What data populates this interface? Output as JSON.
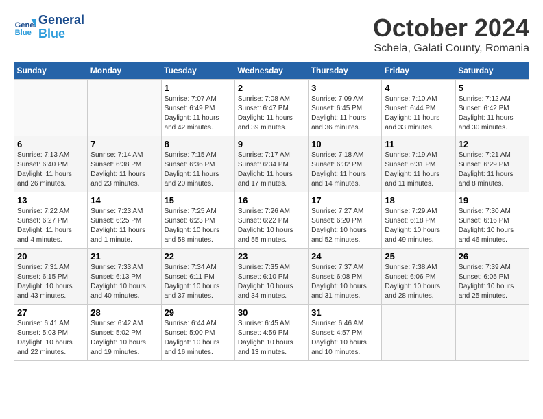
{
  "header": {
    "logo": {
      "line1": "General",
      "line2": "Blue"
    },
    "title": "October 2024",
    "location": "Schela, Galati County, Romania"
  },
  "calendar": {
    "days_of_week": [
      "Sunday",
      "Monday",
      "Tuesday",
      "Wednesday",
      "Thursday",
      "Friday",
      "Saturday"
    ],
    "weeks": [
      [
        {
          "day": "",
          "info": ""
        },
        {
          "day": "",
          "info": ""
        },
        {
          "day": "1",
          "info": "Sunrise: 7:07 AM\nSunset: 6:49 PM\nDaylight: 11 hours and 42 minutes."
        },
        {
          "day": "2",
          "info": "Sunrise: 7:08 AM\nSunset: 6:47 PM\nDaylight: 11 hours and 39 minutes."
        },
        {
          "day": "3",
          "info": "Sunrise: 7:09 AM\nSunset: 6:45 PM\nDaylight: 11 hours and 36 minutes."
        },
        {
          "day": "4",
          "info": "Sunrise: 7:10 AM\nSunset: 6:44 PM\nDaylight: 11 hours and 33 minutes."
        },
        {
          "day": "5",
          "info": "Sunrise: 7:12 AM\nSunset: 6:42 PM\nDaylight: 11 hours and 30 minutes."
        }
      ],
      [
        {
          "day": "6",
          "info": "Sunrise: 7:13 AM\nSunset: 6:40 PM\nDaylight: 11 hours and 26 minutes."
        },
        {
          "day": "7",
          "info": "Sunrise: 7:14 AM\nSunset: 6:38 PM\nDaylight: 11 hours and 23 minutes."
        },
        {
          "day": "8",
          "info": "Sunrise: 7:15 AM\nSunset: 6:36 PM\nDaylight: 11 hours and 20 minutes."
        },
        {
          "day": "9",
          "info": "Sunrise: 7:17 AM\nSunset: 6:34 PM\nDaylight: 11 hours and 17 minutes."
        },
        {
          "day": "10",
          "info": "Sunrise: 7:18 AM\nSunset: 6:32 PM\nDaylight: 11 hours and 14 minutes."
        },
        {
          "day": "11",
          "info": "Sunrise: 7:19 AM\nSunset: 6:31 PM\nDaylight: 11 hours and 11 minutes."
        },
        {
          "day": "12",
          "info": "Sunrise: 7:21 AM\nSunset: 6:29 PM\nDaylight: 11 hours and 8 minutes."
        }
      ],
      [
        {
          "day": "13",
          "info": "Sunrise: 7:22 AM\nSunset: 6:27 PM\nDaylight: 11 hours and 4 minutes."
        },
        {
          "day": "14",
          "info": "Sunrise: 7:23 AM\nSunset: 6:25 PM\nDaylight: 11 hours and 1 minute."
        },
        {
          "day": "15",
          "info": "Sunrise: 7:25 AM\nSunset: 6:23 PM\nDaylight: 10 hours and 58 minutes."
        },
        {
          "day": "16",
          "info": "Sunrise: 7:26 AM\nSunset: 6:22 PM\nDaylight: 10 hours and 55 minutes."
        },
        {
          "day": "17",
          "info": "Sunrise: 7:27 AM\nSunset: 6:20 PM\nDaylight: 10 hours and 52 minutes."
        },
        {
          "day": "18",
          "info": "Sunrise: 7:29 AM\nSunset: 6:18 PM\nDaylight: 10 hours and 49 minutes."
        },
        {
          "day": "19",
          "info": "Sunrise: 7:30 AM\nSunset: 6:16 PM\nDaylight: 10 hours and 46 minutes."
        }
      ],
      [
        {
          "day": "20",
          "info": "Sunrise: 7:31 AM\nSunset: 6:15 PM\nDaylight: 10 hours and 43 minutes."
        },
        {
          "day": "21",
          "info": "Sunrise: 7:33 AM\nSunset: 6:13 PM\nDaylight: 10 hours and 40 minutes."
        },
        {
          "day": "22",
          "info": "Sunrise: 7:34 AM\nSunset: 6:11 PM\nDaylight: 10 hours and 37 minutes."
        },
        {
          "day": "23",
          "info": "Sunrise: 7:35 AM\nSunset: 6:10 PM\nDaylight: 10 hours and 34 minutes."
        },
        {
          "day": "24",
          "info": "Sunrise: 7:37 AM\nSunset: 6:08 PM\nDaylight: 10 hours and 31 minutes."
        },
        {
          "day": "25",
          "info": "Sunrise: 7:38 AM\nSunset: 6:06 PM\nDaylight: 10 hours and 28 minutes."
        },
        {
          "day": "26",
          "info": "Sunrise: 7:39 AM\nSunset: 6:05 PM\nDaylight: 10 hours and 25 minutes."
        }
      ],
      [
        {
          "day": "27",
          "info": "Sunrise: 6:41 AM\nSunset: 5:03 PM\nDaylight: 10 hours and 22 minutes."
        },
        {
          "day": "28",
          "info": "Sunrise: 6:42 AM\nSunset: 5:02 PM\nDaylight: 10 hours and 19 minutes."
        },
        {
          "day": "29",
          "info": "Sunrise: 6:44 AM\nSunset: 5:00 PM\nDaylight: 10 hours and 16 minutes."
        },
        {
          "day": "30",
          "info": "Sunrise: 6:45 AM\nSunset: 4:59 PM\nDaylight: 10 hours and 13 minutes."
        },
        {
          "day": "31",
          "info": "Sunrise: 6:46 AM\nSunset: 4:57 PM\nDaylight: 10 hours and 10 minutes."
        },
        {
          "day": "",
          "info": ""
        },
        {
          "day": "",
          "info": ""
        }
      ]
    ]
  }
}
